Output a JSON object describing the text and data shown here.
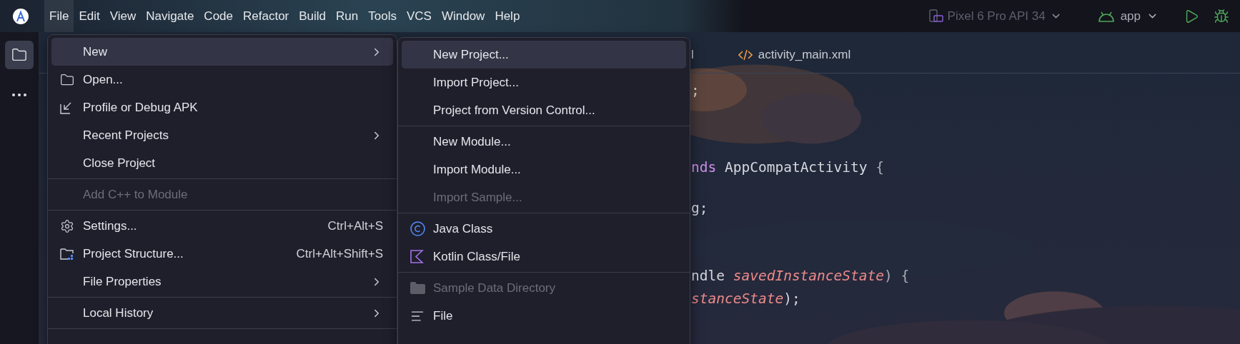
{
  "menu_bar": [
    {
      "label": "File",
      "selected": true
    },
    {
      "label": "Edit",
      "selected": false
    },
    {
      "label": "View",
      "selected": false
    },
    {
      "label": "Navigate",
      "selected": false
    },
    {
      "label": "Code",
      "selected": false
    },
    {
      "label": "Refactor",
      "selected": false
    },
    {
      "label": "Build",
      "selected": false
    },
    {
      "label": "Run",
      "selected": false
    },
    {
      "label": "Tools",
      "selected": false
    },
    {
      "label": "VCS",
      "selected": false
    },
    {
      "label": "Window",
      "selected": false
    },
    {
      "label": "Help",
      "selected": false
    }
  ],
  "toolbar": {
    "device": "Pixel 6 Pro API 34",
    "device_disabled": true,
    "run_config": "app"
  },
  "left_toolbar": {
    "project_selected": true
  },
  "editor": {
    "tabs": [
      {
        "label": "l",
        "selected": false
      },
      {
        "label": "activity_main.xml",
        "selected": false
      }
    ],
    "code_lines": [
      [
        {
          "kind": "plain",
          "text": ";"
        }
      ],
      [
        {
          "kind": "keyword",
          "text": "nds"
        },
        {
          "kind": "plain",
          "text": " AppCompatActivity "
        },
        {
          "kind": "punct",
          "text": "{"
        }
      ],
      [
        {
          "kind": "plain",
          "text": "g;"
        }
      ],
      [
        {
          "kind": "plain",
          "text": "ndle "
        },
        {
          "kind": "param",
          "text": "savedInstanceState"
        },
        {
          "kind": "punct",
          "text": ") {"
        }
      ],
      [
        {
          "kind": "param",
          "text": "stanceState"
        },
        {
          "kind": "plain",
          "text": ");"
        }
      ]
    ]
  },
  "file_menu": {
    "items": [
      {
        "kind": "item",
        "label": "New",
        "submenu": true,
        "selected": true,
        "disabled": false
      },
      {
        "kind": "item",
        "label": "Open...",
        "submenu": false,
        "selected": false,
        "disabled": false
      },
      {
        "kind": "item",
        "label": "Profile or Debug APK",
        "submenu": false,
        "selected": false,
        "disabled": false
      },
      {
        "kind": "item",
        "label": "Recent Projects",
        "submenu": true,
        "selected": false,
        "disabled": false
      },
      {
        "kind": "item",
        "label": "Close Project",
        "submenu": false,
        "selected": false,
        "disabled": false
      },
      {
        "kind": "separator"
      },
      {
        "kind": "item",
        "label": "Add C++ to Module",
        "submenu": false,
        "selected": false,
        "disabled": true
      },
      {
        "kind": "separator"
      },
      {
        "kind": "item",
        "label": "Settings...",
        "shortcut": "Ctrl+Alt+S",
        "submenu": false,
        "selected": false,
        "disabled": false
      },
      {
        "kind": "item",
        "label": "Project Structure...",
        "shortcut": "Ctrl+Alt+Shift+S",
        "submenu": false,
        "selected": false,
        "disabled": false
      },
      {
        "kind": "item",
        "label": "File Properties",
        "submenu": true,
        "selected": false,
        "disabled": false
      },
      {
        "kind": "separator"
      },
      {
        "kind": "item",
        "label": "Local History",
        "submenu": true,
        "selected": false,
        "disabled": false
      },
      {
        "kind": "separator"
      }
    ]
  },
  "new_submenu": {
    "items": [
      {
        "kind": "item",
        "label": "New Project...",
        "submenu": false,
        "selected": true,
        "disabled": false
      },
      {
        "kind": "item",
        "label": "Import Project...",
        "submenu": false,
        "selected": false,
        "disabled": false
      },
      {
        "kind": "item",
        "label": "Project from Version Control...",
        "submenu": false,
        "selected": false,
        "disabled": false
      },
      {
        "kind": "separator"
      },
      {
        "kind": "item",
        "label": "New Module...",
        "submenu": false,
        "selected": false,
        "disabled": false
      },
      {
        "kind": "item",
        "label": "Import Module...",
        "submenu": false,
        "selected": false,
        "disabled": false
      },
      {
        "kind": "item",
        "label": "Import Sample...",
        "submenu": false,
        "selected": false,
        "disabled": true
      },
      {
        "kind": "separator"
      },
      {
        "kind": "item",
        "label": "Java Class",
        "submenu": false,
        "selected": false,
        "disabled": false
      },
      {
        "kind": "item",
        "label": "Kotlin Class/File",
        "submenu": false,
        "selected": false,
        "disabled": false
      },
      {
        "kind": "separator"
      },
      {
        "kind": "item",
        "label": "Sample Data Directory",
        "submenu": false,
        "selected": false,
        "disabled": true
      },
      {
        "kind": "item",
        "label": "File",
        "submenu": false,
        "selected": false,
        "disabled": false
      }
    ]
  }
}
